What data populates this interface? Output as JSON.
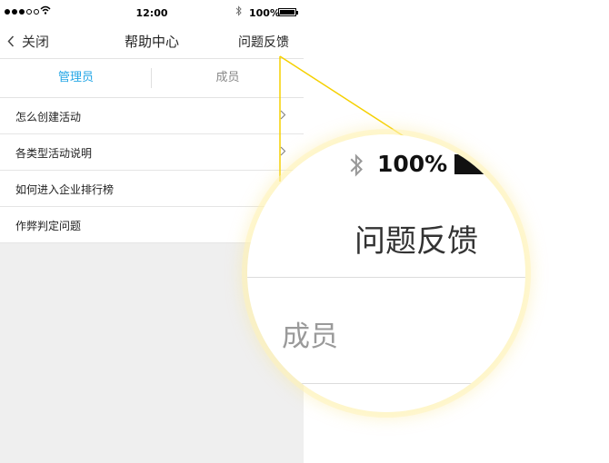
{
  "status_bar": {
    "time": "12:00",
    "battery": "100%"
  },
  "navbar": {
    "back_label": "关闭",
    "title": "帮助中心",
    "feedback_label": "问题反馈"
  },
  "tabs": [
    {
      "label": "管理员",
      "active": true
    },
    {
      "label": "成员",
      "active": false
    }
  ],
  "help_items": [
    {
      "label": "怎么创建活动"
    },
    {
      "label": "各类型活动说明"
    },
    {
      "label": "如何进入企业排行榜"
    },
    {
      "label": "作弊判定问题"
    }
  ],
  "magnifier": {
    "battery": "100%",
    "feedback_label": "问题反馈",
    "tab_label": "成员"
  },
  "colors": {
    "accent": "#23a6e6",
    "callout": "#f5d000",
    "background": "#efefef"
  },
  "icons": [
    "back-chevron-icon",
    "wifi-icon",
    "bluetooth-icon",
    "battery-icon",
    "chevron-right-icon"
  ]
}
